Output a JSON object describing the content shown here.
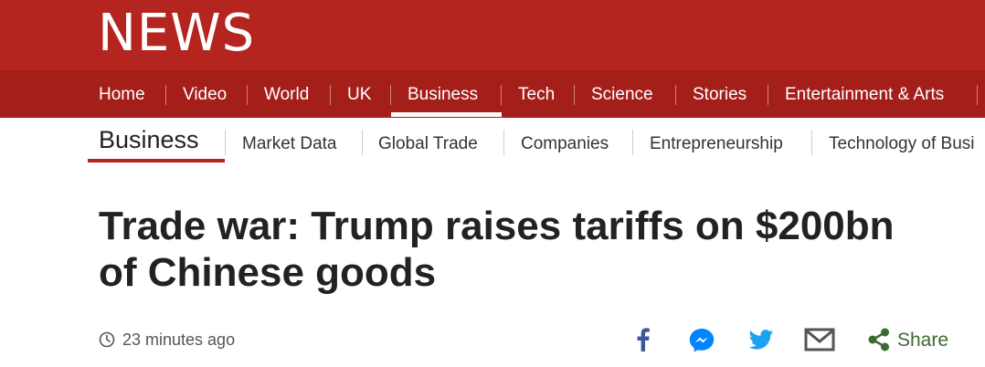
{
  "brand": {
    "logo_text": "NEWS"
  },
  "nav": {
    "items": [
      "Home",
      "Video",
      "World",
      "UK",
      "Business",
      "Tech",
      "Science",
      "Stories",
      "Entertainment & Arts"
    ],
    "active": "Business"
  },
  "subnav": {
    "title": "Business",
    "items": [
      "Market Data",
      "Global Trade",
      "Companies",
      "Entrepreneurship",
      "Technology of Busi"
    ]
  },
  "article": {
    "headline_line1": "Trade war: Trump raises tariffs on $200bn",
    "headline_line2": "of Chinese goods",
    "timestamp": "23 minutes ago"
  },
  "share": {
    "label": "Share",
    "icons": [
      "facebook-icon",
      "messenger-icon",
      "twitter-icon",
      "email-icon",
      "share-icon"
    ]
  },
  "colors": {
    "masthead": "#b5251f",
    "navbar": "#a51f1a",
    "facebook": "#3b5998",
    "messenger": "#0084ff",
    "twitter": "#1da1f2",
    "email": "#555555",
    "share": "#3a6b30"
  }
}
